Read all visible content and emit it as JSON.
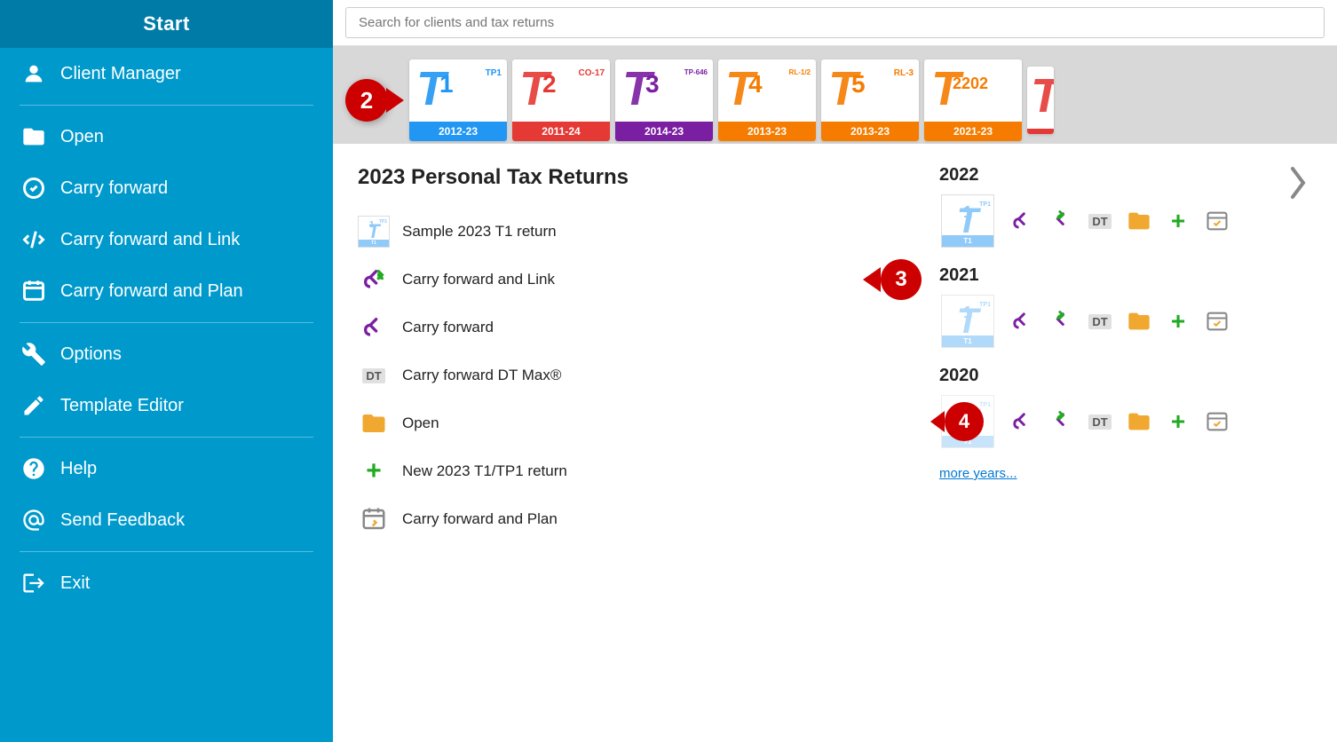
{
  "sidebar": {
    "start_label": "Start",
    "items": [
      {
        "id": "client-manager",
        "label": "Client Manager",
        "icon": "person-icon"
      },
      {
        "id": "open",
        "label": "Open",
        "icon": "open-icon"
      },
      {
        "id": "carry-forward",
        "label": "Carry forward",
        "icon": "cf-icon"
      },
      {
        "id": "carry-forward-link",
        "label": "Carry forward and Link",
        "icon": "cfl-icon"
      },
      {
        "id": "carry-forward-plan",
        "label": "Carry forward and Plan",
        "icon": "cfp-icon"
      },
      {
        "id": "options",
        "label": "Options",
        "icon": "wrench-icon"
      },
      {
        "id": "template-editor",
        "label": "Template Editor",
        "icon": "pencil-icon"
      },
      {
        "id": "help",
        "label": "Help",
        "icon": "help-icon"
      },
      {
        "id": "send-feedback",
        "label": "Send Feedback",
        "icon": "at-icon"
      },
      {
        "id": "exit",
        "label": "Exit",
        "icon": "exit-icon"
      }
    ]
  },
  "search": {
    "placeholder": "Search for clients and tax returns"
  },
  "tax_cards": [
    {
      "id": "t1",
      "letter": "T",
      "number": "1",
      "sub": "TP1",
      "year": "2012-23",
      "color": "blue"
    },
    {
      "id": "t2",
      "letter": "T",
      "number": "2",
      "sub": "CO-17",
      "year": "2011-24",
      "color": "red"
    },
    {
      "id": "t3",
      "letter": "T",
      "number": "3",
      "sub": "TP-646",
      "year": "2014-23",
      "color": "purple"
    },
    {
      "id": "t4",
      "letter": "T",
      "number": "4",
      "sub": "RL-1/2",
      "year": "2013-23",
      "color": "orange"
    },
    {
      "id": "t5",
      "letter": "T",
      "number": "5",
      "sub": "RL-3",
      "year": "2013-23",
      "color": "orange"
    },
    {
      "id": "t2202",
      "letter": "T",
      "number": "2202",
      "sub": "",
      "year": "2021-23",
      "color": "orange"
    }
  ],
  "content": {
    "section_title": "2023 Personal Tax Returns",
    "actions": [
      {
        "id": "sample-t1",
        "label": "Sample 2023 T1 return",
        "icon": "t1-list-icon"
      },
      {
        "id": "carry-forward-link-action",
        "label": "Carry forward and Link",
        "icon": "cfl-action-icon"
      },
      {
        "id": "carry-forward-action",
        "label": "Carry forward",
        "icon": "cf-action-icon"
      },
      {
        "id": "carry-forward-dt",
        "label": "Carry forward DT Max®",
        "icon": "dt-action-icon"
      },
      {
        "id": "open-action",
        "label": "Open",
        "icon": "open-action-icon"
      },
      {
        "id": "new-return",
        "label": "New 2023 T1/TP1 return",
        "icon": "new-action-icon"
      },
      {
        "id": "carry-forward-plan",
        "label": "Carry forward and Plan",
        "icon": "plan-action-icon"
      }
    ],
    "years": [
      {
        "year": "2022",
        "actions": [
          "cf",
          "cfl",
          "dt",
          "open",
          "new",
          "plan"
        ]
      },
      {
        "year": "2021",
        "actions": [
          "cf",
          "cfl",
          "dt",
          "open",
          "new",
          "plan"
        ]
      },
      {
        "year": "2020",
        "actions": [
          "cf",
          "cfl",
          "dt",
          "open",
          "new",
          "plan"
        ]
      }
    ],
    "more_years_label": "more years..."
  },
  "annotations": [
    {
      "id": "anno-2",
      "number": "2",
      "position": "ribbon"
    },
    {
      "id": "anno-3",
      "number": "3",
      "position": "cfl-action"
    },
    {
      "id": "anno-4",
      "number": "4",
      "position": "year-2020"
    }
  ]
}
